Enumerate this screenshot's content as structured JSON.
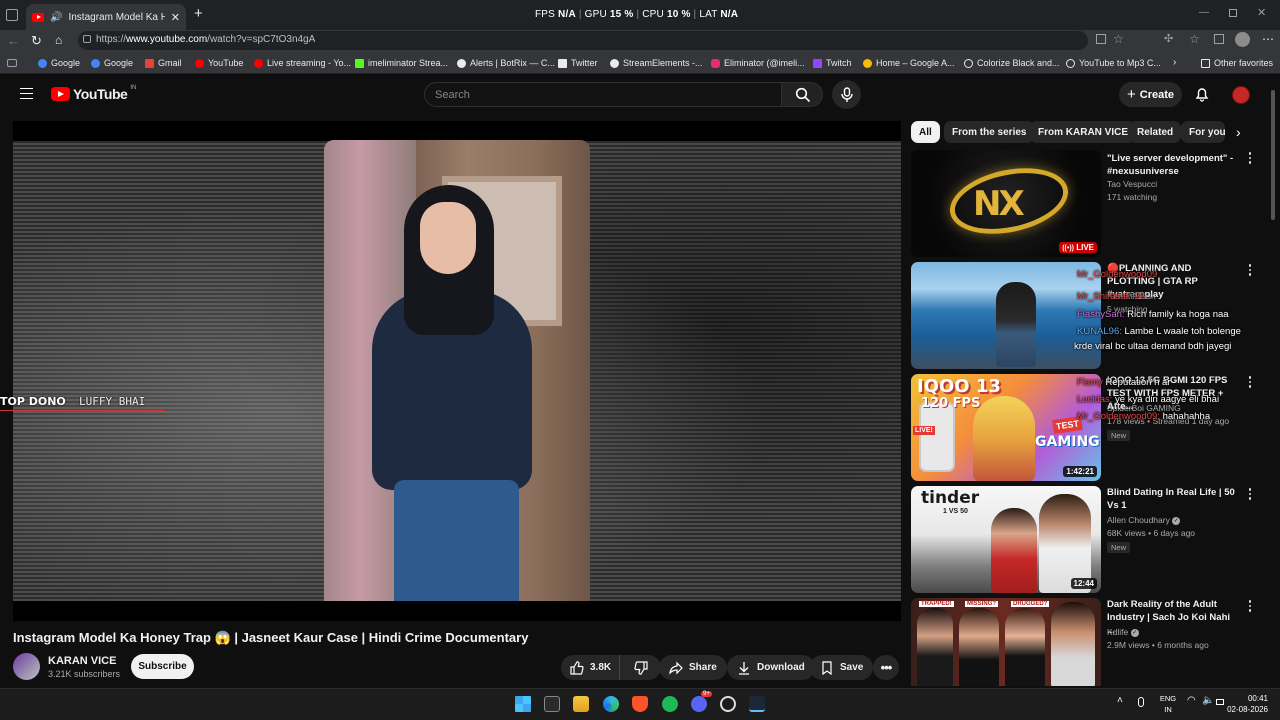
{
  "browser": {
    "tab_title": "Instagram Model Ka Honey Tr",
    "url_prefix": "https://",
    "url_host": "www.youtube.com",
    "url_path": "/watch?v=spC7tO3n4gA",
    "perf": {
      "fps_label": "FPS",
      "fps_value": "N/A",
      "gpu_label": "GPU",
      "gpu_value": "15 %",
      "cpu_label": "CPU",
      "cpu_value": "10 %",
      "lat_label": "LAT",
      "lat_value": "N/A"
    },
    "bookmarks": [
      "Google",
      "Google",
      "Gmail",
      "YouTube",
      "Live streaming - Yo...",
      "imeliminator Strea...",
      "Alerts | BotRix — C...",
      "Twitter",
      "StreamElements -...",
      "Eliminator (@imeli...",
      "Twitch",
      "Home – Google A...",
      "Colorize Black and...",
      "YouTube to Mp3 C..."
    ],
    "other_favorites": "Other favorites"
  },
  "youtube": {
    "logo_text": "YouTube",
    "country": "IN",
    "search_placeholder": "Search",
    "create_label": "Create"
  },
  "player": {
    "overlay_top": "TOP DONO",
    "overlay_name": "LUFFY BHAI"
  },
  "video": {
    "title": "Instagram Model Ka Honey Trap 😱 | Jasneet Kaur Case | Hindi Crime Documentary",
    "channel": "KARAN VICE",
    "subscribers": "3.21K subscribers",
    "subscribe_label": "Subscribe",
    "likes": "3.8K",
    "share_label": "Share",
    "download_label": "Download",
    "save_label": "Save"
  },
  "chips": [
    "All",
    "From the series",
    "From KARAN VICE",
    "Related",
    "For you"
  ],
  "recommendations": [
    {
      "title": "\"Live server development\" - #nexusuniverse",
      "channel": "Tao Vespucci",
      "stats": "171 watching",
      "badge": "",
      "duration": "",
      "live": "LIVE"
    },
    {
      "title": "🔴PLANNING AND PLOTTING | GTA RP #yatrarpplay",
      "channel": "Kawal Akash",
      "stats": "5 watching",
      "badge": "",
      "duration": "",
      "live": ""
    },
    {
      "title": "IQOO 13 5G BGMI 120 FPS TEST WITH FPS METER + Afte...",
      "channel": "SpiderBoi GAMING",
      "stats": "178 views • Streamed 1 day ago",
      "badge": "New",
      "duration": "1:42:21",
      "live": ""
    },
    {
      "title": "Blind Dating In Real Life | 50 Vs 1",
      "channel": "Allen Choudhary",
      "stats": "68K views • 6 days ago",
      "badge": "New",
      "duration": "12:44",
      "live": ""
    },
    {
      "title": "Dark Reality of the Adult Industry | Sach Jo Koi Nahi ...",
      "channel": "Kdlife",
      "stats": "2.9M views • 6 months ago",
      "badge": "",
      "duration": "",
      "live": ""
    }
  ],
  "thumb_text": {
    "iqoo_main": "IQOO 13",
    "iqoo_fps": "120 FPS",
    "iqoo_test": "TEST",
    "iqoo_gaming": "GAMING",
    "iqoo_live": "LIVE!",
    "tinder_logo": "tinder",
    "tinder_sub": "1 VS 50",
    "dark_tag1": "TRAPPED!",
    "dark_tag2": "MISSING?",
    "dark_tag3": "DRUGGED?"
  },
  "chat": [
    {
      "user": "Mr_Goldenwood09",
      "msg": "",
      "color": "#d94a4a"
    },
    {
      "user": "Mr_Shirasakii26",
      "msg": "",
      "color": "#d94a4a"
    },
    {
      "user": "FlashySan:",
      "msg": "Rich family ka hoga naa",
      "color": "#c86bd6"
    },
    {
      "user": "KUNAL96:",
      "msg": "Lambe L waale toh bolenge",
      "color": "#5fa8e8"
    },
    {
      "user": "",
      "msg": "krde viral bc ultaa demand bdh jayegi",
      "color": "#ffffff"
    },
    {
      "user": "Flamy",
      "msg": "Reputation h ar",
      "color": "#d94a4a"
    },
    {
      "user": "Lucidas:",
      "msg": "ye kya din aagye eli bhai",
      "color": "#d94a4a"
    },
    {
      "user": "Mr_Goldenwood09:",
      "msg": "hahahahha",
      "color": "#d94a4a"
    }
  ],
  "taskbar": {
    "lang_top": "ENG",
    "lang_bottom": "IN",
    "time": "00:41",
    "date": "02-08-2026",
    "discord_badge": "9+"
  },
  "colors": {
    "yt_red": "#ff0000",
    "bg": "#0f0f0f",
    "chip_bg": "#272727"
  }
}
